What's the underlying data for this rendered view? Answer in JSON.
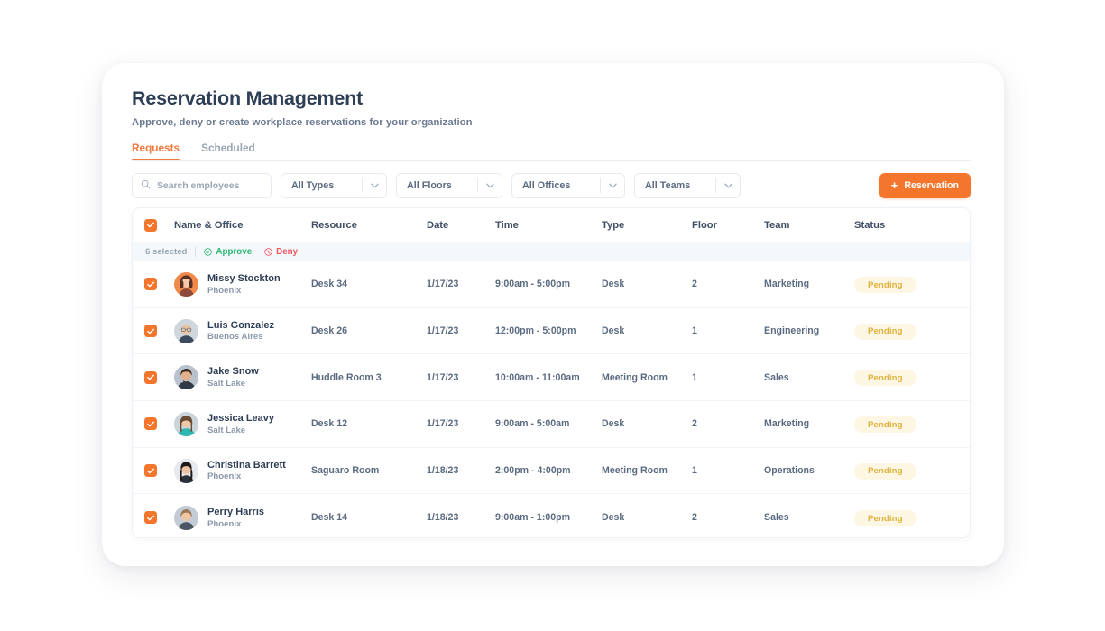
{
  "header": {
    "title": "Reservation Management",
    "subtitle": "Approve, deny or create workplace reservations for your organization"
  },
  "tabs": [
    {
      "label": "Requests",
      "active": true
    },
    {
      "label": "Scheduled",
      "active": false
    }
  ],
  "toolbar": {
    "search": {
      "placeholder": "Search employees",
      "value": "",
      "icon": "search-icon"
    },
    "filters": [
      {
        "name": "types",
        "label": "All Types"
      },
      {
        "name": "floors",
        "label": "All Floors"
      },
      {
        "name": "offices",
        "label": "All Offices"
      },
      {
        "name": "teams",
        "label": "All Teams"
      }
    ],
    "add_button": {
      "label": "Reservation",
      "icon": "plus-icon"
    }
  },
  "table": {
    "columns": [
      "Name & Office",
      "Resource",
      "Date",
      "Time",
      "Type",
      "Floor",
      "Team",
      "Status"
    ],
    "select_all_checked": true,
    "selection_bar": {
      "count_label": "6 selected",
      "approve_label": "Approve",
      "deny_label": "Deny"
    },
    "rows": [
      {
        "checked": true,
        "avatar": "avatar-missy-stockton",
        "name": "Missy Stockton",
        "office": "Phoenix",
        "resource": "Desk 34",
        "date": "1/17/23",
        "time": "9:00am - 5:00pm",
        "type": "Desk",
        "floor": "2",
        "team": "Marketing",
        "status": "Pending"
      },
      {
        "checked": true,
        "avatar": "avatar-luis-gonzalez",
        "name": "Luis Gonzalez",
        "office": "Buenos Aires",
        "resource": "Desk 26",
        "date": "1/17/23",
        "time": "12:00pm - 5:00pm",
        "type": "Desk",
        "floor": "1",
        "team": "Engineering",
        "status": "Pending"
      },
      {
        "checked": true,
        "avatar": "avatar-jake-snow",
        "name": "Jake Snow",
        "office": "Salt Lake",
        "resource": "Huddle Room 3",
        "date": "1/17/23",
        "time": "10:00am - 11:00am",
        "type": "Meeting Room",
        "floor": "1",
        "team": "Sales",
        "status": "Pending"
      },
      {
        "checked": true,
        "avatar": "avatar-jessica-leavy",
        "name": "Jessica Leavy",
        "office": "Salt Lake",
        "resource": "Desk 12",
        "date": "1/17/23",
        "time": "9:00am - 5:00am",
        "type": "Desk",
        "floor": "2",
        "team": "Marketing",
        "status": "Pending"
      },
      {
        "checked": true,
        "avatar": "avatar-christina-barrett",
        "name": "Christina Barrett",
        "office": "Phoenix",
        "resource": "Saguaro Room",
        "date": "1/18/23",
        "time": "2:00pm - 4:00pm",
        "type": "Meeting Room",
        "floor": "1",
        "team": "Operations",
        "status": "Pending"
      },
      {
        "checked": true,
        "avatar": "avatar-perry-harris",
        "name": "Perry Harris",
        "office": "Phoenix",
        "resource": "Desk 14",
        "date": "1/18/23",
        "time": "9:00am - 1:00pm",
        "type": "Desk",
        "floor": "2",
        "team": "Sales",
        "status": "Pending"
      }
    ]
  },
  "colors": {
    "accent": "#f4762d",
    "tab_active": "#f07a3f",
    "title": "#2e3e56",
    "muted": "#8b99ab",
    "approve": "#2bb673",
    "deny": "#f2575f",
    "badge_bg": "#fdf6e3",
    "badge_text": "#e0b13c",
    "selection_bar_bg": "#f5f8fb",
    "page_bg": "#ffffff"
  }
}
